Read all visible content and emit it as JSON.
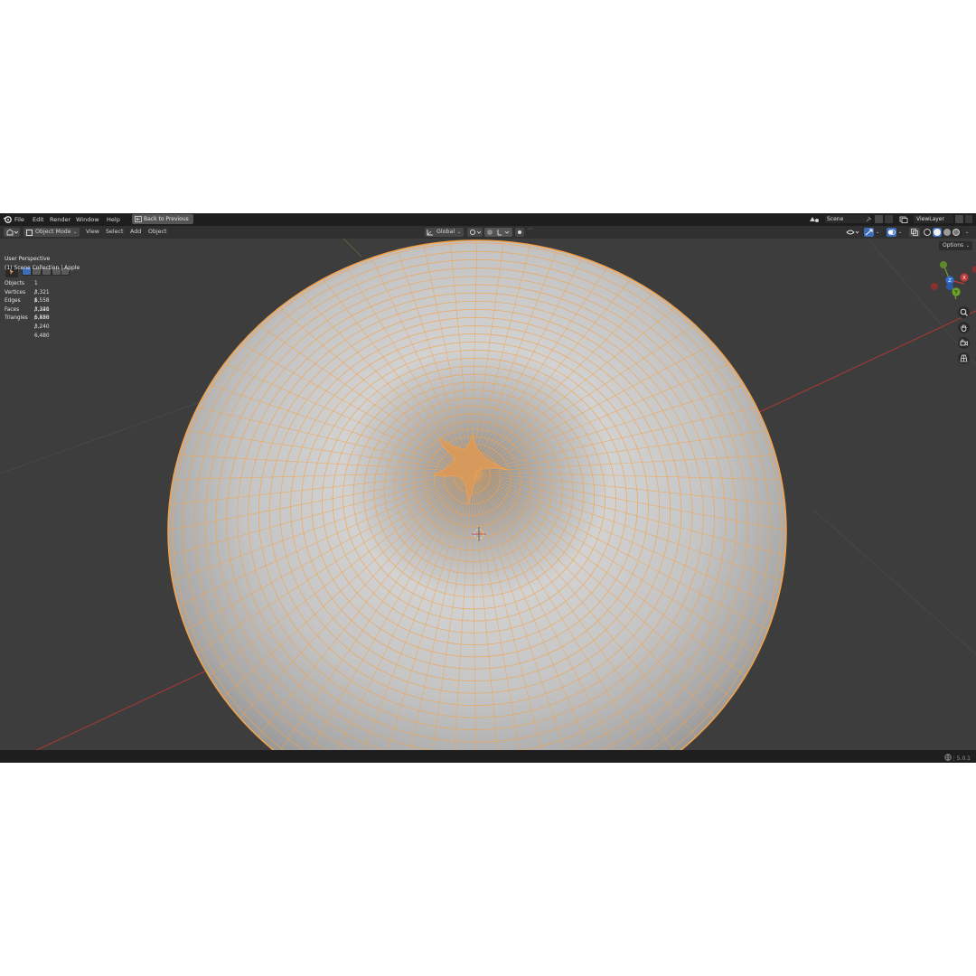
{
  "menu": {
    "items": [
      "File",
      "Edit",
      "Render",
      "Window",
      "Help"
    ],
    "back_label": "Back to Previous",
    "scene": "Scene",
    "view_layer": "ViewLayer"
  },
  "header": {
    "mode": "Object Mode",
    "menus": [
      "View",
      "Select",
      "Add",
      "Object"
    ],
    "orientation": "Global",
    "options": "Options"
  },
  "overlay": {
    "perspective": "User Perspective",
    "collection": "(1) Scene Collection | Apple"
  },
  "stats": [
    {
      "label": "Objects",
      "value": "1 / 1"
    },
    {
      "label": "Vertices",
      "value": "3,321 / 3,321"
    },
    {
      "label": "Edges",
      "value": "6,558 / 6,558"
    },
    {
      "label": "Faces",
      "value": "3,240 / 3,240"
    },
    {
      "label": "Triangles",
      "value": "6,480 / 6,480"
    }
  ],
  "gizmo": {
    "x": "X",
    "y": "Y",
    "z": "Z"
  },
  "status": {
    "version": "5.0.1"
  },
  "colors": {
    "selection_wire": "#f3a24a",
    "mesh_surface": "#b8b8b8",
    "viewport_bg": "#3d3d3d",
    "x_axis": "#c03a3a",
    "y_axis": "#6aa22b",
    "z_axis": "#2f6fd1"
  },
  "icons": [
    "blender-logo-icon",
    "back-icon",
    "editor-type-icon",
    "object-mode-icon",
    "orientation-icon",
    "pivot-icon",
    "snap-icon",
    "proportional-icon",
    "visibility-icon",
    "gizmo-icon",
    "overlay-icon",
    "xray-icon",
    "shading-solid-icon",
    "zoom-icon",
    "hand-pan-icon",
    "camera-icon",
    "grid-icon",
    "globe-icon"
  ]
}
